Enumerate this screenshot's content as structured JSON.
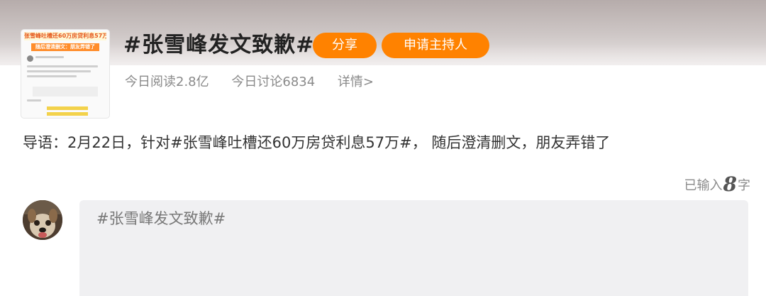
{
  "topic": {
    "title": "#张雪峰发文致歉#",
    "share_label": "分享",
    "apply_host_label": "申请主持人"
  },
  "stats": {
    "reads": "今日阅读2.8亿",
    "discussions": "今日讨论6834",
    "details": "详情>"
  },
  "guide": "导语：2月22日，针对#张雪峰吐槽还60万房贷利息57万#， 随后澄清删文，朋友弄错了",
  "composer": {
    "counter_prefix": "已输入",
    "counter_value": "8",
    "counter_suffix": "字",
    "text": "#张雪峰发文致歉#"
  },
  "thumbnail": {
    "headline": "张雪峰吐槽还60万房贷利息57万",
    "banner": "随后澄清删文：朋友弄错了"
  },
  "colors": {
    "accent": "#ff8200",
    "muted_text": "#8a8a8a",
    "editor_bg": "#f0f0f2"
  }
}
